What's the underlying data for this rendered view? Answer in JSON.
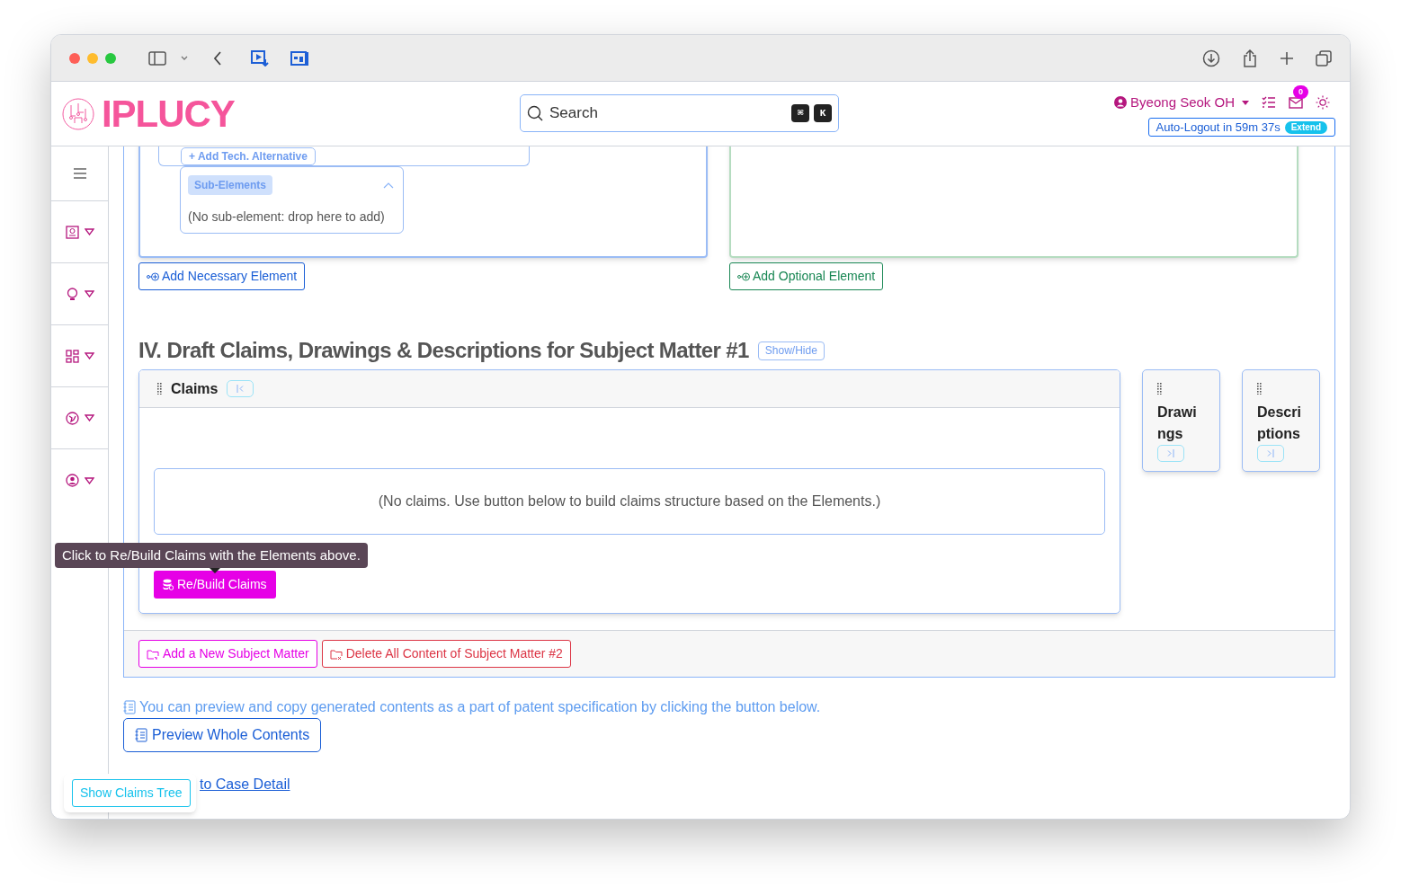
{
  "header": {
    "logo": "IPLUCY",
    "search": {
      "placeholder": "Search",
      "keys": [
        "⌘",
        "K"
      ]
    },
    "user": "Byeong Seok OH",
    "notifications": "0",
    "auto_logout": "Auto-Logout in 59m 37s",
    "extend": "Extend"
  },
  "elements": {
    "add_alternative": "+ Add Tech. Alternative",
    "sub_elements": {
      "label": "Sub-Elements",
      "expanded": true,
      "empty": "(No sub-element: drop here to add)"
    },
    "buttons": [
      {
        "kind": "necessary",
        "label": "Add Necessary Element"
      },
      {
        "kind": "optional",
        "label": "Add Optional Element"
      }
    ]
  },
  "section": {
    "title": "IV. Draft Claims, Drawings & Descriptions for Subject Matter #1",
    "toggle": "Show/Hide",
    "panels": [
      {
        "title": "Claims",
        "expanded": true
      },
      {
        "title": "Drawings",
        "expanded": false
      },
      {
        "title": "Descriptions",
        "expanded": false
      }
    ],
    "claims_empty": "(No claims. Use button below to build claims structure based on the Elements.)",
    "tooltip": "Click to Re/Build Claims with the Elements above.",
    "rebuild": "Re/Build Claims"
  },
  "footer_buttons": [
    {
      "kind": "add",
      "label": "Add a New Subject Matter"
    },
    {
      "kind": "delete",
      "label": "Delete All Content of Subject Matter #2"
    }
  ],
  "info": "You can preview and copy generated contents as a part of patent specification by clicking the button below.",
  "preview": "Preview Whole Contents",
  "back_link": "to Case Detail",
  "claims_tree": "Show Claims Tree"
}
